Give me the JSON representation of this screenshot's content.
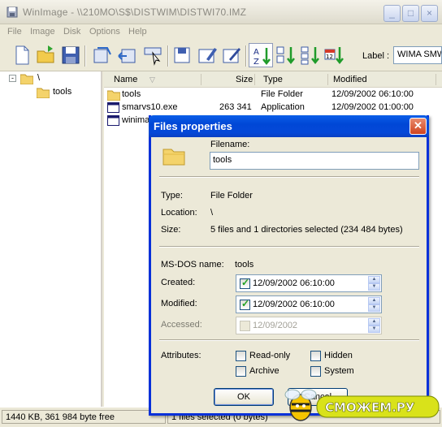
{
  "window": {
    "title": "WinImage - \\\\210MO\\S$\\DISTWIM\\DISTWI70.IMZ"
  },
  "menu": [
    "File",
    "Image",
    "Disk",
    "Options",
    "Help"
  ],
  "toolbar": {
    "buttons": [
      "new-icon",
      "open-icon",
      "save-icon",
      "inject-icon",
      "extract-icon",
      "cursor-icon",
      "format-icon",
      "edit-icon",
      "properties-icon",
      "sort-name-icon",
      "sort-ext-icon",
      "sort-size-icon",
      "sort-date-icon"
    ],
    "label_text": "Label :",
    "label_value": "WIMA SMW"
  },
  "tree": {
    "expander": "-",
    "root": "\\",
    "child": "tools"
  },
  "list": {
    "columns": [
      "Name",
      "Size",
      "Type",
      "Modified"
    ],
    "rows": [
      {
        "name": "tools",
        "size": "",
        "type": "File Folder",
        "modified": "12/09/2002 06:10:00"
      },
      {
        "name": "smarvs10.exe",
        "size": "263 341",
        "type": "Application",
        "modified": "12/09/2002 01:00:00"
      },
      {
        "name": "winima",
        "size": "",
        "type": "",
        "modified": ""
      }
    ]
  },
  "status": {
    "left": "1440 KB, 361 984 byte free",
    "right": "1 files selected (0 bytes)"
  },
  "dialog": {
    "title": "Files properties",
    "filename_label": "Filename:",
    "filename_value": "tools",
    "type_label": "Type:",
    "type_value": "File Folder",
    "location_label": "Location:",
    "location_value": "\\",
    "size_label": "Size:",
    "size_value": "5 files and 1 directories selected (234 484 bytes)",
    "msdos_label": "MS-DOS name:",
    "msdos_value": "tools",
    "created_label": "Created:",
    "created_value": "12/09/2002 06:10:00",
    "modified_label": "Modified:",
    "modified_value": "12/09/2002 06:10:00",
    "accessed_label": "Accessed:",
    "accessed_value": "12/09/2002",
    "attributes_label": "Attributes:",
    "attrs": [
      "Read-only",
      "Hidden",
      "Archive",
      "System"
    ],
    "ok": "OK",
    "cancel": "Cancel"
  },
  "watermark": {
    "text": "СМОЖЕМ.РУ"
  },
  "colors": {
    "dialog_title": "#0047d6",
    "window_bg": "#ece9d8",
    "selection_accent": "#316ac5"
  }
}
